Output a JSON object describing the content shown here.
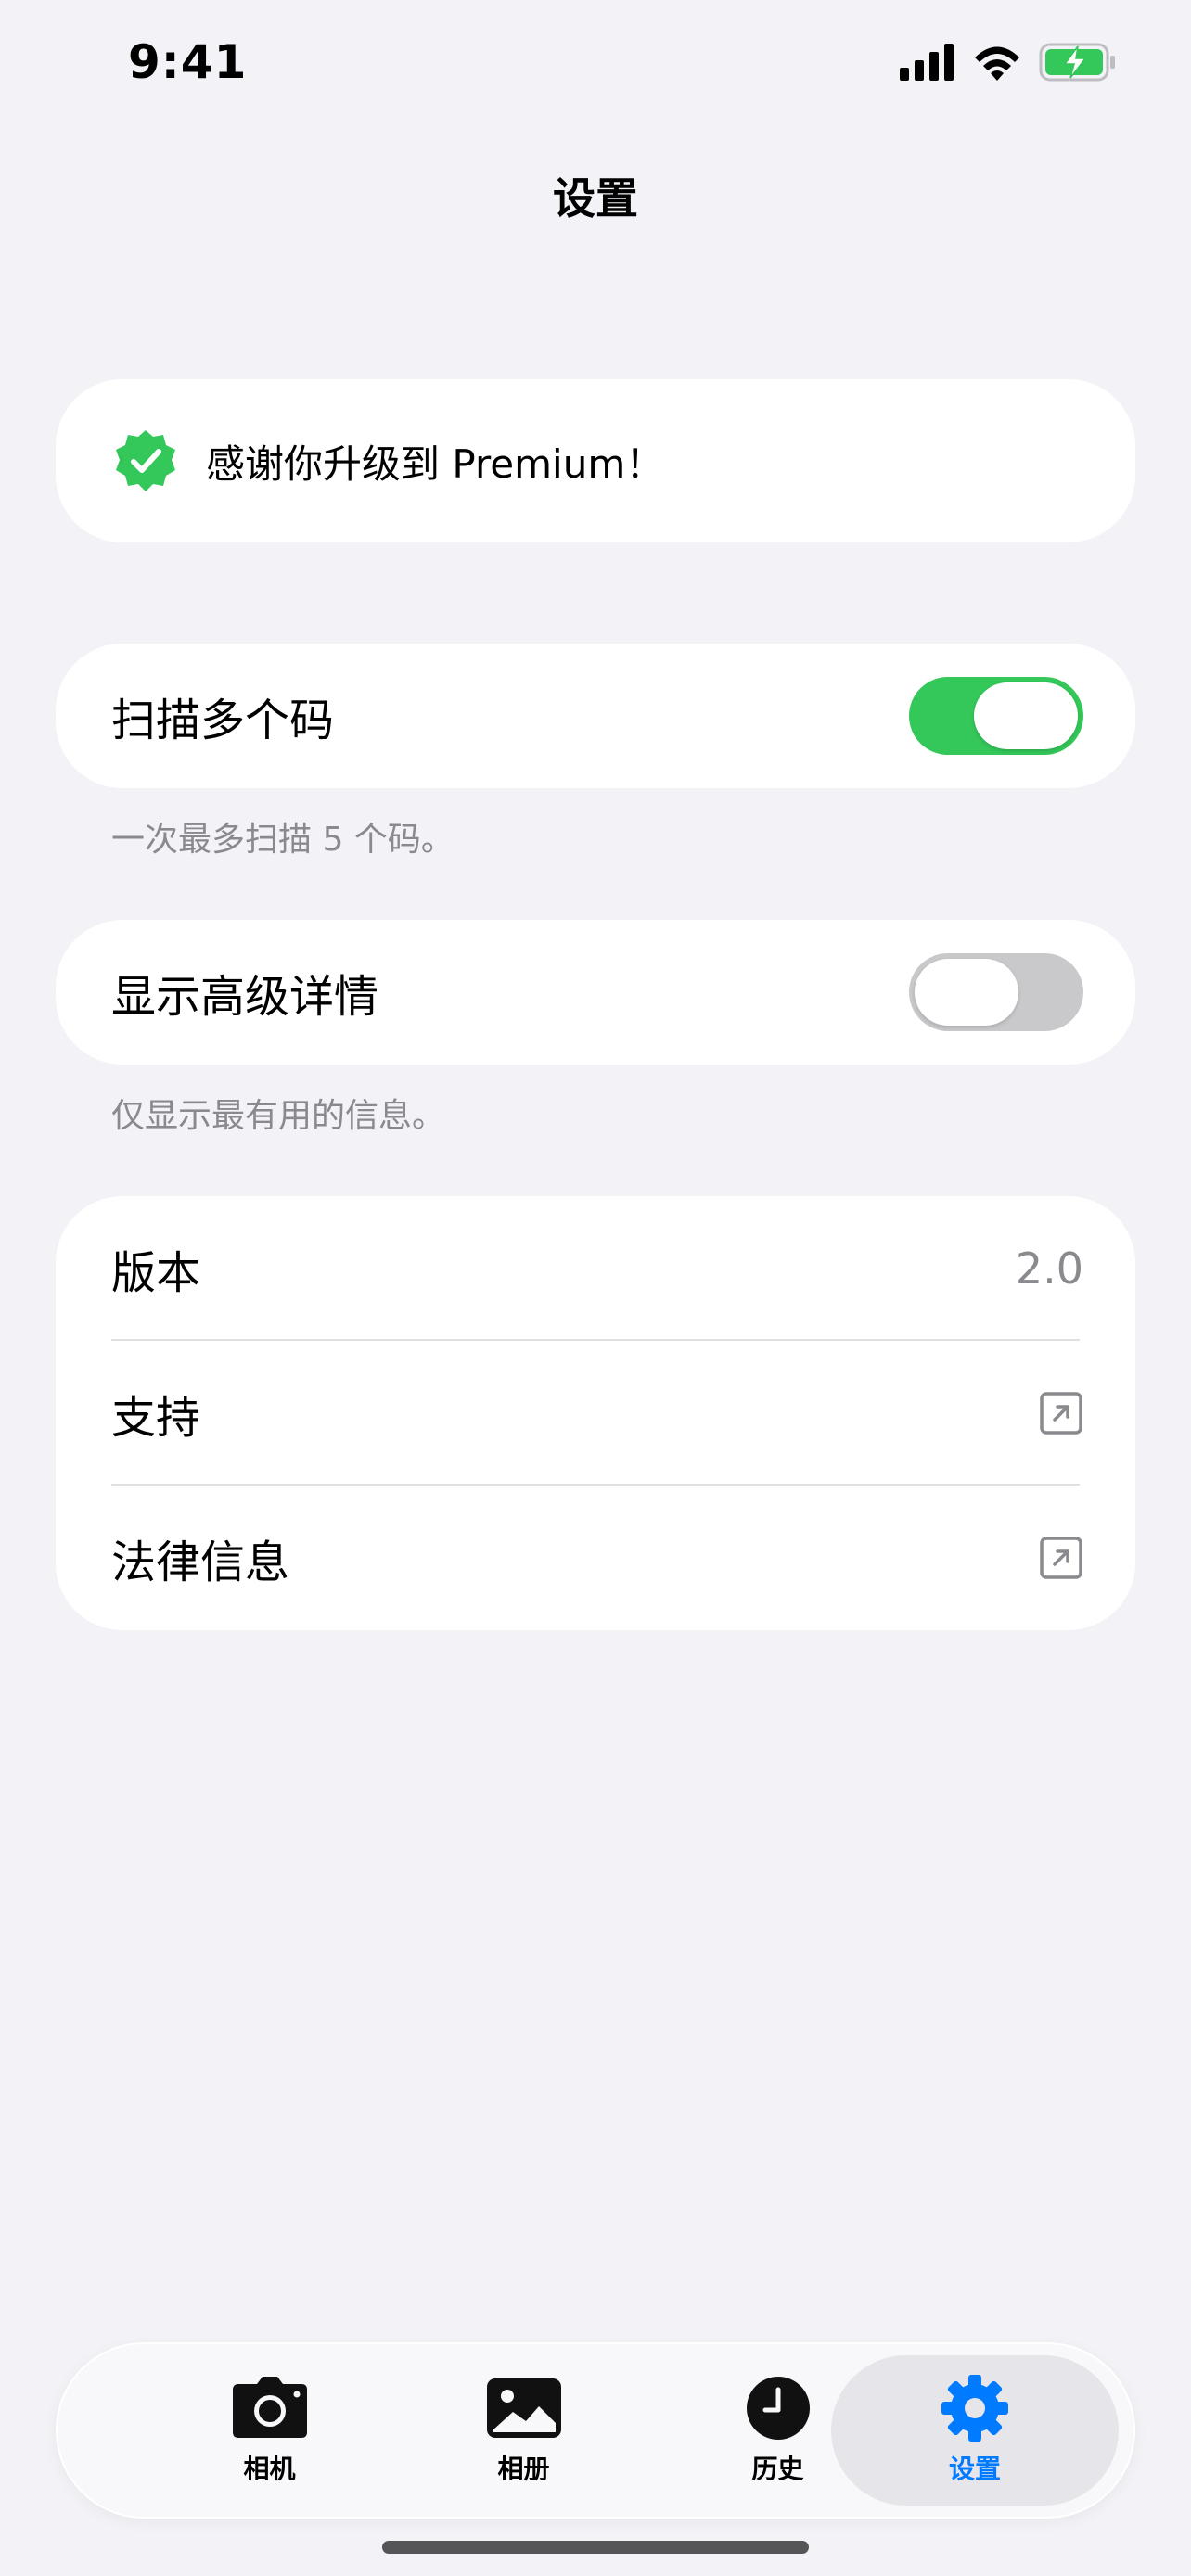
{
  "status_bar": {
    "time": "9:41"
  },
  "header": {
    "title": "设置"
  },
  "premium": {
    "message": "感谢你升级到 Premium！",
    "badge_color": "#34C759"
  },
  "settings": {
    "scan_multiple": {
      "label": "扫描多个码",
      "enabled": true,
      "footnote": "一次最多扫描 5 个码。"
    },
    "advanced_details": {
      "label": "显示高级详情",
      "enabled": false,
      "footnote": "仅显示最有用的信息。"
    }
  },
  "info": {
    "version": {
      "label": "版本",
      "value": "2.0"
    },
    "support": {
      "label": "支持",
      "icon": "external-link-icon"
    },
    "legal": {
      "label": "法律信息",
      "icon": "external-link-icon"
    }
  },
  "tabbar": {
    "tabs": [
      {
        "label": "相机",
        "icon": "camera-icon"
      },
      {
        "label": "相册",
        "icon": "photo-icon"
      },
      {
        "label": "历史",
        "icon": "clock-icon"
      },
      {
        "label": "设置",
        "icon": "gear-icon"
      }
    ],
    "active_index": 3,
    "accent_color": "#007AFF"
  },
  "colors": {
    "background": "#F2F2F7",
    "toggle_on": "#34C759",
    "toggle_off": "#C9C9CC"
  }
}
